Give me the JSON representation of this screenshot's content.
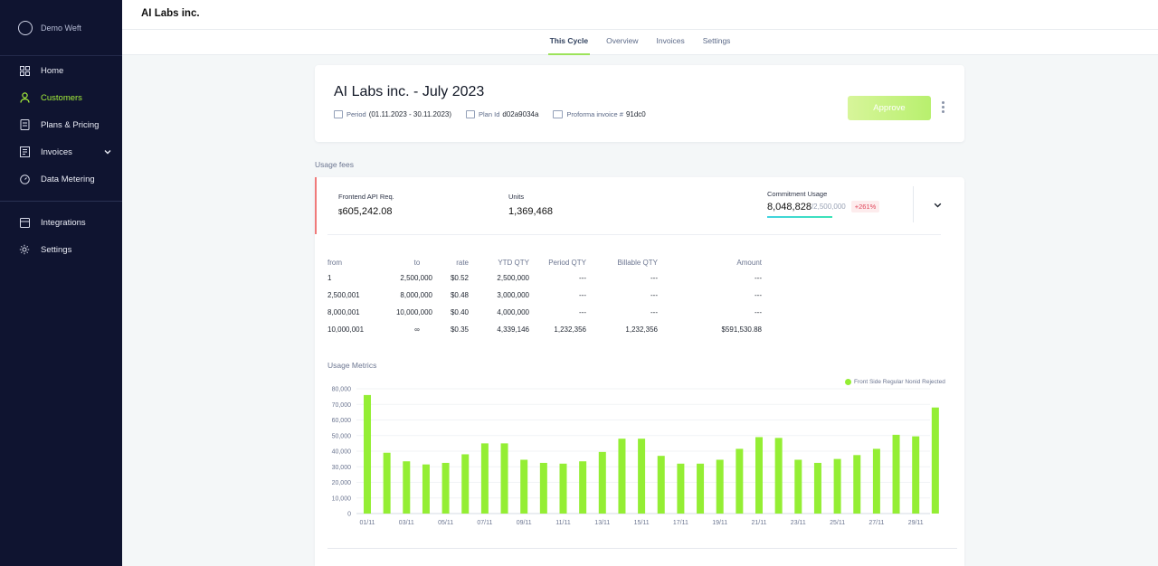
{
  "sidebar": {
    "brand": "Demo Weft",
    "items": [
      {
        "label": "Home",
        "icon": "grid-icon",
        "active": false
      },
      {
        "label": "Customers",
        "icon": "user-icon",
        "active": true
      },
      {
        "label": "Plans & Pricing",
        "icon": "tag-icon",
        "active": false
      },
      {
        "label": "Invoices",
        "icon": "invoice-icon",
        "active": false
      },
      {
        "label": "Data Metering",
        "icon": "gauge-icon",
        "active": false
      }
    ],
    "items2": [
      {
        "label": "Integrations",
        "icon": "integrations-icon"
      },
      {
        "label": "Settings",
        "icon": "gear-icon"
      }
    ]
  },
  "header": {
    "title": "AI Labs inc."
  },
  "tabs": [
    {
      "label": "This Cycle",
      "active": true
    },
    {
      "label": "Overview",
      "active": false
    },
    {
      "label": "Invoices",
      "active": false
    },
    {
      "label": "Settings",
      "active": false
    }
  ],
  "invoice": {
    "title": "AI Labs inc. - July 2023",
    "period_label": "Period",
    "period_value": "(01.11.2023 - 30.11.2023)",
    "plan_label": "Plan Id",
    "plan_value": "d02a9034a",
    "proforma_label": "Proforma invoice #",
    "proforma_value": "91dc0",
    "approve_label": "Approve"
  },
  "usage_fees_label": "Usage fees",
  "summary": {
    "metric_label": "Frontend API Req.",
    "currency": "$",
    "amount": "605,242.08",
    "units_label": "Units",
    "units_value": "1,369,468",
    "commitment_label": "Commitment Usage",
    "commitment_value": "8,048,828",
    "commitment_of": "/2,500,000",
    "commitment_badge": "+261%"
  },
  "tiers": {
    "headers": [
      "from",
      "to",
      "rate",
      "YTD QTY",
      "Period QTY",
      "Billable QTY",
      "Amount"
    ],
    "rows": [
      [
        "1",
        "2,500,000",
        "$0.52",
        "2,500,000",
        "---",
        "---",
        "---"
      ],
      [
        "2,500,001",
        "8,000,000",
        "$0.48",
        "3,000,000",
        "---",
        "---",
        "---"
      ],
      [
        "8,000,001",
        "10,000,000",
        "$0.40",
        "4,000,000",
        "---",
        "---",
        "---"
      ],
      [
        "10,000,001",
        "∞",
        "$0.35",
        "4,339,146",
        "1,232,356",
        "1,232,356",
        "$591,530.88"
      ]
    ]
  },
  "metrics_label": "Usage Metrics",
  "chart_data": {
    "type": "bar",
    "series": [
      {
        "name": "Front Side Regular Nonid Rejected",
        "color": "#94ee34",
        "values": [
          76000,
          39000,
          33500,
          31500,
          32500,
          38000,
          45000,
          45000,
          34500,
          32500,
          32000,
          33500,
          39500,
          48000,
          48000,
          37000,
          32000,
          32000,
          34500,
          41500,
          49000,
          48500,
          34500,
          32500,
          35000,
          37500,
          41500,
          50500,
          49500,
          68000
        ]
      }
    ],
    "categories": [
      "01/11",
      "02/11",
      "03/11",
      "04/11",
      "05/11",
      "06/11",
      "07/11",
      "08/11",
      "09/11",
      "10/11",
      "11/11",
      "12/11",
      "13/11",
      "14/11",
      "15/11",
      "16/11",
      "17/11",
      "18/11",
      "19/11",
      "20/11",
      "21/11",
      "22/11",
      "23/11",
      "24/11",
      "25/11",
      "26/11",
      "27/11",
      "28/11",
      "29/11",
      "30/11"
    ],
    "tick_labels": [
      "01/11",
      "03/11",
      "05/11",
      "07/11",
      "09/11",
      "11/11",
      "13/11",
      "15/11",
      "17/11",
      "19/11",
      "21/11",
      "23/11",
      "25/11",
      "27/11",
      "29/11"
    ],
    "yticks": [
      "0",
      "10,000",
      "20,000",
      "30,000",
      "40,000",
      "50,000",
      "60,000",
      "70,000",
      "80,000"
    ],
    "ylim": [
      0,
      80000
    ],
    "grid": true,
    "legend": "top-right"
  }
}
